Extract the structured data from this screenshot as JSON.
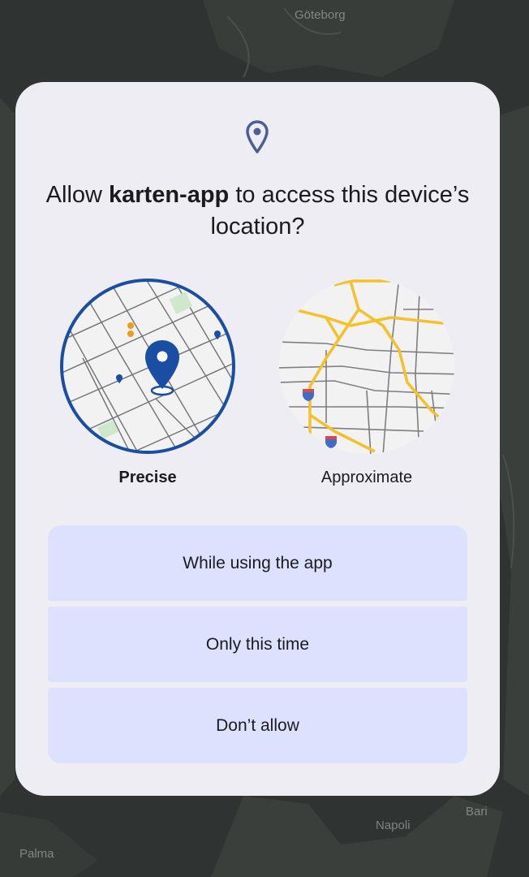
{
  "background_map": {
    "labels": [
      "Göteborg",
      "Napoli",
      "Bari",
      "Palma"
    ]
  },
  "dialog": {
    "icon": "location-pin-icon",
    "title_prefix": "Allow ",
    "app_name": "karten-app",
    "title_suffix": " to access this device’s location?",
    "options": {
      "precise": {
        "label": "Precise",
        "selected": true
      },
      "approximate": {
        "label": "Approximate",
        "selected": false
      }
    },
    "buttons": {
      "while_using": "While using the app",
      "only_this_time": "Only this time",
      "dont_allow": "Don’t allow"
    }
  },
  "colors": {
    "dialog_bg": "#eeedf3",
    "button_bg": "#dce2fd",
    "accent_blue": "#1a4ea3",
    "icon_blue": "#4c5f94",
    "road_yellow": "#f5c029"
  }
}
